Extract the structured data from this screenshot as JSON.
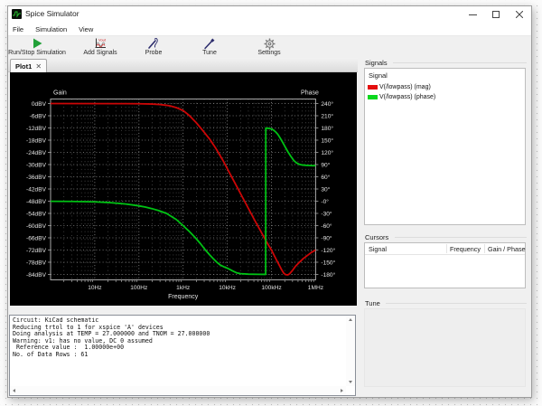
{
  "window": {
    "title": "Spice Simulator",
    "controls": {
      "minimize": "minimize",
      "maximize": "maximize",
      "close": "close"
    }
  },
  "menu": {
    "items": [
      "File",
      "Simulation",
      "View"
    ]
  },
  "toolbar": {
    "buttons": [
      {
        "label": "Run/Stop Simulation",
        "icon": "play-icon"
      },
      {
        "label": "Add Signals",
        "icon": "waveform-icon"
      },
      {
        "label": "Probe",
        "icon": "probe-icon"
      },
      {
        "label": "Tune",
        "icon": "tuner-icon"
      },
      {
        "label": "Settings",
        "icon": "gear-icon"
      }
    ]
  },
  "tabs": [
    {
      "label": "Plot1",
      "active": true
    }
  ],
  "chart_data": {
    "type": "line",
    "x_scale": "log",
    "xlabel": "Frequency",
    "ylabel_left": "Gain",
    "ylabel_right": "Phase",
    "x_range_hz": [
      1,
      1000000
    ],
    "x_tick_labels": [
      "10Hz",
      "100Hz",
      "1kHz",
      "10kHz",
      "100kHz",
      "1MHz"
    ],
    "x_tick_hz": [
      10,
      100,
      1000,
      10000,
      100000,
      1000000
    ],
    "y_left_ticks": [
      "0dBV",
      "-6dBV",
      "-12dBV",
      "-18dBV",
      "-24dBV",
      "-30dBV",
      "-36dBV",
      "-42dBV",
      "-48dBV",
      "-54dBV",
      "-60dBV",
      "-66dBV",
      "-72dBV",
      "-78dBV",
      "-84dBV"
    ],
    "y_left_range_dbv": [
      0,
      -84
    ],
    "y_right_ticks": [
      "240°",
      "210°",
      "180°",
      "150°",
      "120°",
      "90°",
      "60°",
      "30°",
      "-0°",
      "-30°",
      "-60°",
      "-90°",
      "-120°",
      "-150°",
      "-180°"
    ],
    "y_right_range_deg": [
      240,
      -180
    ],
    "grid": true,
    "series": [
      {
        "name": "V(/lowpass) (mag)",
        "axis": "left",
        "unit": "dBV",
        "color": "#cc0606",
        "points": [
          [
            1,
            0
          ],
          [
            50,
            -0.05
          ],
          [
            100,
            -0.12
          ],
          [
            200,
            -0.25
          ],
          [
            300,
            -0.5
          ],
          [
            400,
            -0.8
          ],
          [
            500,
            -1.1
          ],
          [
            700,
            -2.0
          ],
          [
            1000,
            -3.4
          ],
          [
            1400,
            -6.0
          ],
          [
            2000,
            -9.5
          ],
          [
            2800,
            -13.3
          ],
          [
            4000,
            -17.5
          ],
          [
            5600,
            -22.3
          ],
          [
            8000,
            -28
          ],
          [
            11000,
            -33.7
          ],
          [
            16000,
            -40.3
          ],
          [
            22000,
            -46
          ],
          [
            30000,
            -51.5
          ],
          [
            42000,
            -57.5
          ],
          [
            58000,
            -63
          ],
          [
            80000,
            -68.5
          ],
          [
            100000,
            -72
          ],
          [
            115000,
            -74.6
          ],
          [
            130000,
            -76.9
          ],
          [
            150000,
            -79.4
          ],
          [
            170000,
            -81.7
          ],
          [
            190000,
            -83.4
          ],
          [
            210000,
            -84.1
          ],
          [
            235000,
            -84.2
          ],
          [
            260000,
            -83.6
          ],
          [
            300000,
            -82
          ],
          [
            350000,
            -80
          ],
          [
            430000,
            -78
          ],
          [
            520000,
            -76.3
          ],
          [
            650000,
            -74.7
          ],
          [
            800000,
            -73.2
          ],
          [
            1000000,
            -72
          ]
        ]
      },
      {
        "name": "V(/lowpass) (phase)",
        "axis": "right",
        "unit": "deg",
        "color": "#00c214",
        "points": [
          [
            1,
            -0.2
          ],
          [
            3,
            -0.5
          ],
          [
            10,
            -1.6
          ],
          [
            20,
            -3.2
          ],
          [
            30,
            -4.8
          ],
          [
            40,
            -6
          ],
          [
            50,
            -7
          ],
          [
            70,
            -9
          ],
          [
            100,
            -11.5
          ],
          [
            140,
            -14.5
          ],
          [
            200,
            -18.5
          ],
          [
            280,
            -23
          ],
          [
            420,
            -30
          ],
          [
            700,
            -45
          ],
          [
            1000,
            -60
          ],
          [
            1400,
            -75
          ],
          [
            1900,
            -90
          ],
          [
            2500,
            -105
          ],
          [
            3200,
            -120
          ],
          [
            4000,
            -132
          ],
          [
            4800,
            -141
          ],
          [
            5800,
            -150
          ],
          [
            7000,
            -157
          ],
          [
            8500,
            -161.5
          ],
          [
            10200,
            -165
          ],
          [
            13000,
            -171
          ],
          [
            16300,
            -176
          ],
          [
            20000,
            -178
          ],
          [
            30000,
            -179.3
          ],
          [
            50000,
            -179.7
          ],
          [
            74000,
            -179.9
          ],
          [
            74500,
            179.8
          ],
          [
            82000,
            179.3
          ],
          [
            92000,
            178.5
          ],
          [
            100000,
            177.3
          ],
          [
            112000,
            174.5
          ],
          [
            125000,
            170
          ],
          [
            140000,
            164
          ],
          [
            162000,
            153
          ],
          [
            185000,
            142
          ],
          [
            210000,
            131
          ],
          [
            240000,
            120
          ],
          [
            280000,
            109
          ],
          [
            320000,
            100
          ],
          [
            370000,
            94
          ],
          [
            430000,
            90.5
          ],
          [
            500000,
            89
          ],
          [
            600000,
            88.2
          ],
          [
            700000,
            87.8
          ],
          [
            850000,
            87.4
          ],
          [
            1000000,
            87.2
          ]
        ]
      }
    ]
  },
  "console": {
    "lines": [
      "Circuit: KiCad schematic",
      "Reducing trtol to 1 for xspice 'A' devices",
      "Doing analysis at TEMP = 27.000000 and TNOM = 27.000000",
      "Warning: v1: has no value, DC 0 assumed",
      " Reference value :  1.00000e+00",
      "No. of Data Rows : 61"
    ]
  },
  "signals_panel": {
    "title": "Signals",
    "column": "Signal",
    "rows": [
      {
        "label": "V(/lowpass) (mag)",
        "color": "#e40e0e"
      },
      {
        "label": "V(/lowpass) (phase)",
        "color": "#0ad81e"
      }
    ]
  },
  "cursors_panel": {
    "title": "Cursors",
    "columns": [
      "Signal",
      "Frequency",
      "Gain / Phase"
    ],
    "rows": []
  },
  "tune_panel": {
    "title": "Tune"
  }
}
